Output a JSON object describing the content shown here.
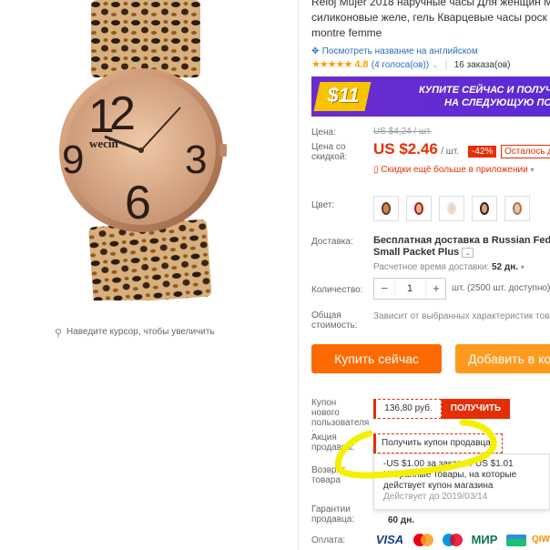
{
  "zoom_hint": "Наведите курсор, чтобы увеличить",
  "product": {
    "title_lines": [
      "Reloj Mujer 2018 наручные часы Для женщин M",
      "силиконовые желе, гель Кварцевые часы роск",
      "montre femme"
    ],
    "translate_link": "Посмотреть название на английском",
    "rating": "4.8",
    "votes": "(4 голоса(ов))",
    "orders": "16 заказа(ов)",
    "watch_brand": "wecin"
  },
  "banner": {
    "amount": "$11",
    "line1": "КУПИТЕ СЕЙЧАС И ПОЛУЧ",
    "line2": "НА СЛЕДУЮЩУЮ ПО"
  },
  "price": {
    "label": "Цена:",
    "old": "US $4,24 / шт.",
    "discount_label": "Цена со скидкой:",
    "new": "US $2.46",
    "unit": "/ шт.",
    "discount": "-42%",
    "remaining": "Осталось д",
    "app_promo": "Скидки ещё больше в приложении"
  },
  "color": {
    "label": "Цвет:"
  },
  "shipping": {
    "label": "Доставка:",
    "line1": "Бесплатная доставка в Russian Federatio",
    "line2": "Small Packet Plus",
    "eta_label": "Расчетное время доставки:",
    "eta_value": "52 дн."
  },
  "quantity": {
    "label": "Количество:",
    "value": "1",
    "minus": "−",
    "plus": "+",
    "available": "шт. (2500 шт. доступно)"
  },
  "total": {
    "label": "Общая стоимость:",
    "value": "Зависит от выбранных характеристик това"
  },
  "buttons": {
    "buy_now": "Купить сейчас",
    "add_to_cart": "Добавить в ко"
  },
  "coupons": {
    "new_user_label": "Купон нового пользователя :",
    "new_user_value": "136,80 руб.",
    "get_button": "ПОЛУЧИТЬ",
    "seller_label": "Акция продавца:",
    "seller_button": "Получить купон продавца",
    "return_label": "Возврат товара",
    "guarantee_label": "Гарантии продавца:",
    "guarantee_value": "60 дн.",
    "popup_line1": "-US $1.00 за заказ от US $1.01",
    "popup_line2": "Избранные товары, на которые",
    "popup_line3": "действует купон магазина",
    "popup_line4": "Действует до 2019/03/14"
  },
  "payment": {
    "label": "Оплата:",
    "methods": [
      "VISA",
      "MC",
      "MAE",
      "МИР",
      "QIWI"
    ]
  },
  "colors": {
    "orange": "#ff6a00",
    "red": "#e62e04",
    "highlight": "#f4f000",
    "blue_link": "#2a6fb7"
  }
}
